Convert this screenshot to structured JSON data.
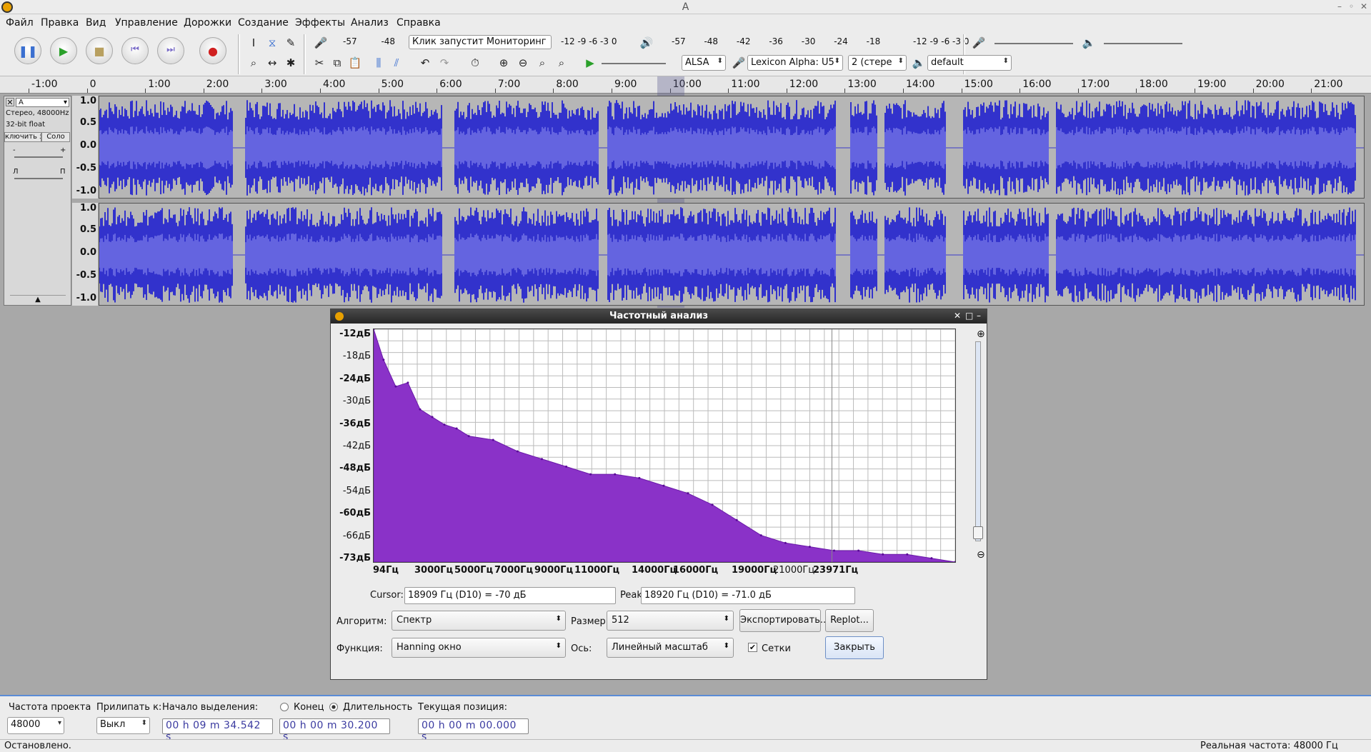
{
  "window": {
    "title": "A"
  },
  "menu": [
    "Файл",
    "Правка",
    "Вид",
    "Управление",
    "Дорожки",
    "Создание",
    "Эффекты",
    "Анализ",
    "Справка"
  ],
  "transport": {
    "pause": "pause",
    "play": "play",
    "stop": "stop",
    "skip_start": "skip-start",
    "skip_end": "skip-end",
    "record": "record"
  },
  "meters": {
    "record_ticks": [
      "-57",
      "-48"
    ],
    "monitor_hint": "Клик запустит Мониторинг",
    "record_ticks_right": [
      "-12",
      "-9",
      "-6",
      "-3",
      "0"
    ],
    "play_ticks": [
      "-57",
      "-48",
      "-42",
      "-36",
      "-30",
      "-24",
      "-18",
      "-12",
      "-9",
      "-6",
      "-3",
      "0"
    ]
  },
  "device": {
    "host": "ALSA",
    "input": "Lexicon Alpha: U5",
    "channels": "2 (стере",
    "output": "default"
  },
  "ruler": {
    "ticks": [
      "-1:00",
      "0",
      "1:00",
      "2:00",
      "3:00",
      "4:00",
      "5:00",
      "6:00",
      "7:00",
      "8:00",
      "9:00",
      "10:00",
      "11:00",
      "12:00",
      "13:00",
      "14:00",
      "15:00",
      "16:00",
      "17:00",
      "18:00",
      "19:00",
      "20:00",
      "21:00"
    ]
  },
  "track": {
    "name": "A",
    "info1": "Стерео, 48000Hz",
    "info2": "32-bit float",
    "mute": "ключить звук",
    "solo": "Соло",
    "gain_minus": "-",
    "gain_plus": "+",
    "pan_left": "Л",
    "pan_right": "П",
    "scale": [
      "1.0",
      "0.5",
      "0.0",
      "-0.5",
      "-1.0"
    ]
  },
  "dialog": {
    "title": "Частотный анализ",
    "y_labels": [
      "-12дБ",
      "-18дБ",
      "-24дБ",
      "-30дБ",
      "-36дБ",
      "-42дБ",
      "-48дБ",
      "-54дБ",
      "-60дБ",
      "-66дБ",
      "-73дБ"
    ],
    "x_labels": [
      "94Гц",
      "3000Гц",
      "5000Гц",
      "7000Гц",
      "9000Гц",
      "11000Гц",
      "14000Гц",
      "16000Гц",
      "19000Гц",
      "21000Гц",
      "23971Гц"
    ],
    "cursor_label": "Cursor:",
    "cursor_value": "18909 Гц (D10) = -70 дБ",
    "peak_label": "Peak:",
    "peak_value": "18920 Гц (D10) = -71.0 дБ",
    "algorithm_label": "Алгоритм:",
    "algorithm_value": "Спектр",
    "size_label": "Размер:",
    "size_value": "512",
    "export_button": "Экспортировать...",
    "replot_button": "Replot...",
    "function_label": "Функция:",
    "function_value": "Hanning окно",
    "axis_label": "Ось:",
    "axis_value": "Линейный масштаб",
    "grid_label": "Сетки",
    "grid_checked": true,
    "close_button": "Закрыть"
  },
  "chart_data": {
    "type": "area",
    "title": "",
    "xlabel": "",
    "ylabel": "",
    "x_unit": "Hz",
    "y_unit": "dB",
    "xlim": [
      94,
      23971
    ],
    "ylim": [
      -73,
      -12
    ],
    "grid": true,
    "x": [
      94,
      500,
      1000,
      1500,
      2000,
      2500,
      3000,
      3500,
      4000,
      5000,
      6000,
      7000,
      8000,
      9000,
      10000,
      11000,
      12000,
      13000,
      14000,
      15000,
      16000,
      17000,
      18000,
      19000,
      20000,
      21000,
      22000,
      23000,
      23971
    ],
    "values": [
      -12,
      -20,
      -27,
      -26,
      -33,
      -35,
      -37,
      -38,
      -40,
      -41,
      -44,
      -46,
      -48,
      -50,
      -50,
      -51,
      -53,
      -55,
      -58,
      -62,
      -66,
      -68,
      -69,
      -70,
      -70,
      -71,
      -71,
      -72,
      -73
    ]
  },
  "bottom": {
    "rate_label": "Частота проекта",
    "rate_value": "48000",
    "snap_label": "Прилипать к:",
    "snap_value": "Выкл",
    "sel_start_label": "Начало выделения:",
    "end_label": "Конец",
    "length_label": "Длительность",
    "position_label": "Текущая позиция:",
    "sel_start": "00 h 09 m 34.542 s",
    "sel_length": "00 h 00 m 30.200 s",
    "position": "00 h 00 m 00.000 s"
  },
  "status": {
    "left": "Остановлено.",
    "right": "Реальная частота: 48000 Гц"
  }
}
